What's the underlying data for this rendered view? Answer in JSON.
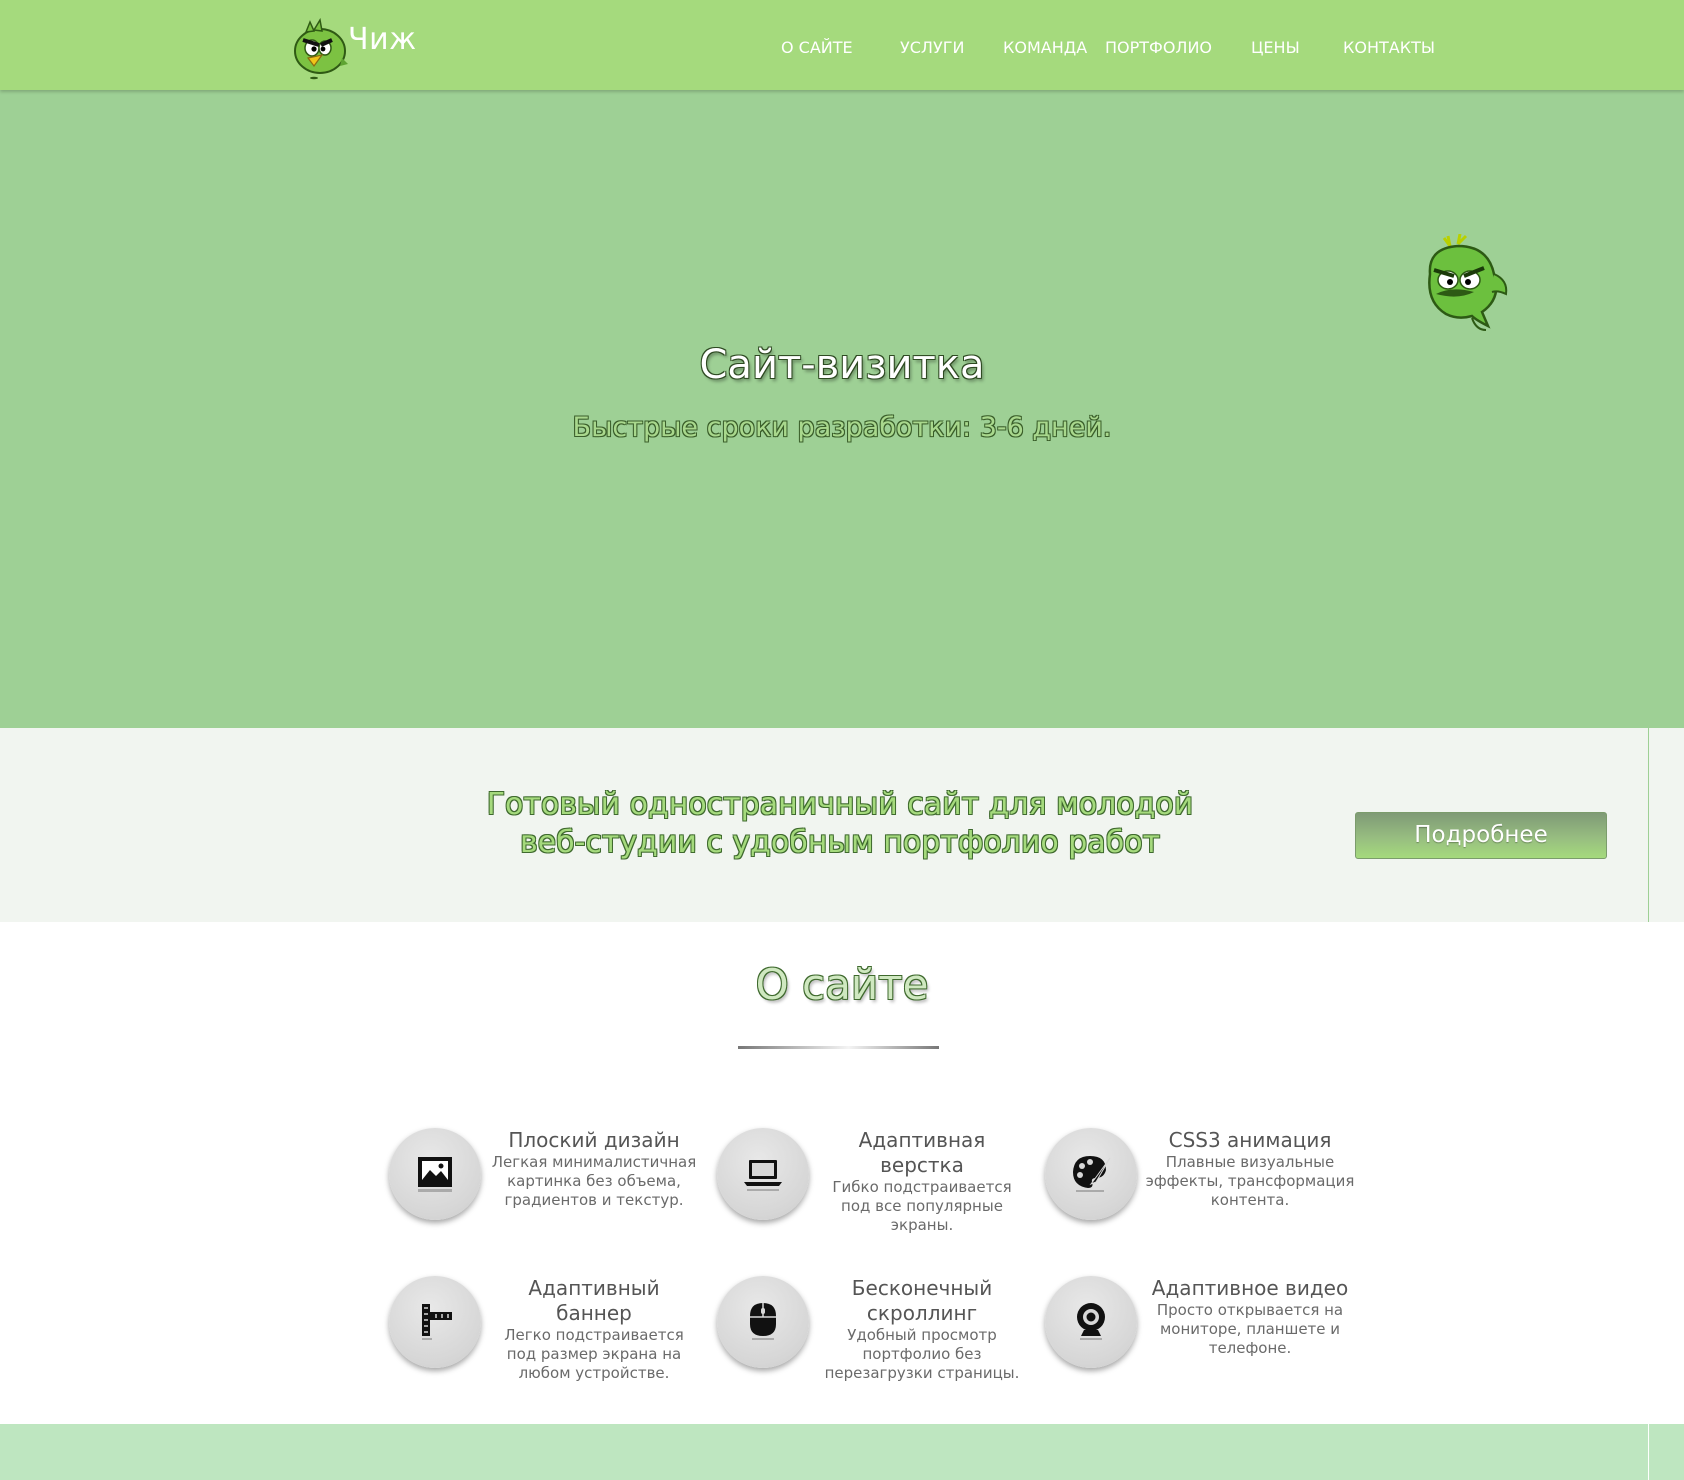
{
  "header": {
    "logo_text": "Чиж",
    "nav": [
      {
        "label": "О САЙТЕ"
      },
      {
        "label": "УСЛУГИ"
      },
      {
        "label": "КОМАНДА"
      },
      {
        "label": "ПОРТФОЛИО"
      },
      {
        "label": "ЦЕНЫ"
      },
      {
        "label": "КОНТАКТЫ"
      }
    ]
  },
  "hero": {
    "title": "Сайт-визитка",
    "subtitle": "Быстрые сроки разработки: 3-6 дней."
  },
  "promo": {
    "line1": "Готовый одностраничный сайт для молодой",
    "line2": "веб-студии с удобным портфолио работ",
    "button_label": "Подробнее"
  },
  "about": {
    "title": "О сайте",
    "features": [
      {
        "icon": "image-icon",
        "title": "Плоский дизайн",
        "desc": "Легкая минималистичная картинка без объема, градиентов и текстур."
      },
      {
        "icon": "laptop-icon",
        "title": "Адаптивная верстка",
        "desc": "Гибко подстраивается под все популярные экраны."
      },
      {
        "icon": "palette-icon",
        "title": "CSS3 анимация",
        "desc": "Плавные визуальные эффекты, трансформация контента."
      },
      {
        "icon": "ruler-icon",
        "title": "Адаптивный баннер",
        "desc": "Легко подстраивается под размер экрана на любом устройстве."
      },
      {
        "icon": "mouse-icon",
        "title": "Бесконечный скроллинг",
        "desc": "Удобный просмотр портфолио без перезагрузки страницы."
      },
      {
        "icon": "webcam-icon",
        "title": "Адаптивное видео",
        "desc": "Просто открывается на мониторе, планшете и телефоне."
      }
    ]
  },
  "colors": {
    "header_bg": "#a5da7d",
    "hero_bg": "#9ed095",
    "promo_bg": "#f1f5f0",
    "bottom_band_bg": "#bee6c0",
    "accent": "#a5da7d"
  }
}
